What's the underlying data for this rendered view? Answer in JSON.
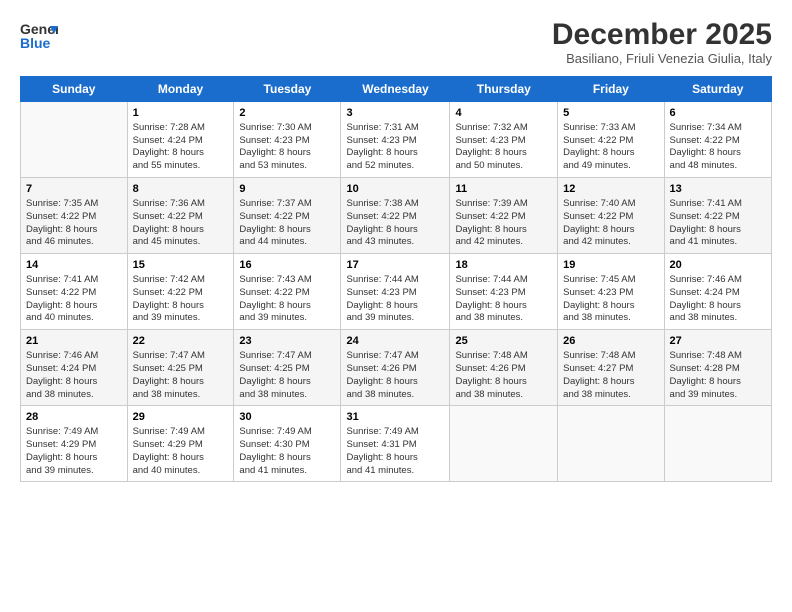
{
  "header": {
    "logo_line1": "General",
    "logo_line2": "Blue",
    "title": "December 2025",
    "subtitle": "Basiliano, Friuli Venezia Giulia, Italy"
  },
  "days_of_week": [
    "Sunday",
    "Monday",
    "Tuesday",
    "Wednesday",
    "Thursday",
    "Friday",
    "Saturday"
  ],
  "weeks": [
    [
      {
        "day": "",
        "detail": ""
      },
      {
        "day": "1",
        "detail": "Sunrise: 7:28 AM\nSunset: 4:24 PM\nDaylight: 8 hours\nand 55 minutes."
      },
      {
        "day": "2",
        "detail": "Sunrise: 7:30 AM\nSunset: 4:23 PM\nDaylight: 8 hours\nand 53 minutes."
      },
      {
        "day": "3",
        "detail": "Sunrise: 7:31 AM\nSunset: 4:23 PM\nDaylight: 8 hours\nand 52 minutes."
      },
      {
        "day": "4",
        "detail": "Sunrise: 7:32 AM\nSunset: 4:23 PM\nDaylight: 8 hours\nand 50 minutes."
      },
      {
        "day": "5",
        "detail": "Sunrise: 7:33 AM\nSunset: 4:22 PM\nDaylight: 8 hours\nand 49 minutes."
      },
      {
        "day": "6",
        "detail": "Sunrise: 7:34 AM\nSunset: 4:22 PM\nDaylight: 8 hours\nand 48 minutes."
      }
    ],
    [
      {
        "day": "7",
        "detail": "Sunrise: 7:35 AM\nSunset: 4:22 PM\nDaylight: 8 hours\nand 46 minutes."
      },
      {
        "day": "8",
        "detail": "Sunrise: 7:36 AM\nSunset: 4:22 PM\nDaylight: 8 hours\nand 45 minutes."
      },
      {
        "day": "9",
        "detail": "Sunrise: 7:37 AM\nSunset: 4:22 PM\nDaylight: 8 hours\nand 44 minutes."
      },
      {
        "day": "10",
        "detail": "Sunrise: 7:38 AM\nSunset: 4:22 PM\nDaylight: 8 hours\nand 43 minutes."
      },
      {
        "day": "11",
        "detail": "Sunrise: 7:39 AM\nSunset: 4:22 PM\nDaylight: 8 hours\nand 42 minutes."
      },
      {
        "day": "12",
        "detail": "Sunrise: 7:40 AM\nSunset: 4:22 PM\nDaylight: 8 hours\nand 42 minutes."
      },
      {
        "day": "13",
        "detail": "Sunrise: 7:41 AM\nSunset: 4:22 PM\nDaylight: 8 hours\nand 41 minutes."
      }
    ],
    [
      {
        "day": "14",
        "detail": "Sunrise: 7:41 AM\nSunset: 4:22 PM\nDaylight: 8 hours\nand 40 minutes."
      },
      {
        "day": "15",
        "detail": "Sunrise: 7:42 AM\nSunset: 4:22 PM\nDaylight: 8 hours\nand 39 minutes."
      },
      {
        "day": "16",
        "detail": "Sunrise: 7:43 AM\nSunset: 4:22 PM\nDaylight: 8 hours\nand 39 minutes."
      },
      {
        "day": "17",
        "detail": "Sunrise: 7:44 AM\nSunset: 4:23 PM\nDaylight: 8 hours\nand 39 minutes."
      },
      {
        "day": "18",
        "detail": "Sunrise: 7:44 AM\nSunset: 4:23 PM\nDaylight: 8 hours\nand 38 minutes."
      },
      {
        "day": "19",
        "detail": "Sunrise: 7:45 AM\nSunset: 4:23 PM\nDaylight: 8 hours\nand 38 minutes."
      },
      {
        "day": "20",
        "detail": "Sunrise: 7:46 AM\nSunset: 4:24 PM\nDaylight: 8 hours\nand 38 minutes."
      }
    ],
    [
      {
        "day": "21",
        "detail": "Sunrise: 7:46 AM\nSunset: 4:24 PM\nDaylight: 8 hours\nand 38 minutes."
      },
      {
        "day": "22",
        "detail": "Sunrise: 7:47 AM\nSunset: 4:25 PM\nDaylight: 8 hours\nand 38 minutes."
      },
      {
        "day": "23",
        "detail": "Sunrise: 7:47 AM\nSunset: 4:25 PM\nDaylight: 8 hours\nand 38 minutes."
      },
      {
        "day": "24",
        "detail": "Sunrise: 7:47 AM\nSunset: 4:26 PM\nDaylight: 8 hours\nand 38 minutes."
      },
      {
        "day": "25",
        "detail": "Sunrise: 7:48 AM\nSunset: 4:26 PM\nDaylight: 8 hours\nand 38 minutes."
      },
      {
        "day": "26",
        "detail": "Sunrise: 7:48 AM\nSunset: 4:27 PM\nDaylight: 8 hours\nand 38 minutes."
      },
      {
        "day": "27",
        "detail": "Sunrise: 7:48 AM\nSunset: 4:28 PM\nDaylight: 8 hours\nand 39 minutes."
      }
    ],
    [
      {
        "day": "28",
        "detail": "Sunrise: 7:49 AM\nSunset: 4:29 PM\nDaylight: 8 hours\nand 39 minutes."
      },
      {
        "day": "29",
        "detail": "Sunrise: 7:49 AM\nSunset: 4:29 PM\nDaylight: 8 hours\nand 40 minutes."
      },
      {
        "day": "30",
        "detail": "Sunrise: 7:49 AM\nSunset: 4:30 PM\nDaylight: 8 hours\nand 41 minutes."
      },
      {
        "day": "31",
        "detail": "Sunrise: 7:49 AM\nSunset: 4:31 PM\nDaylight: 8 hours\nand 41 minutes."
      },
      {
        "day": "",
        "detail": ""
      },
      {
        "day": "",
        "detail": ""
      },
      {
        "day": "",
        "detail": ""
      }
    ]
  ]
}
